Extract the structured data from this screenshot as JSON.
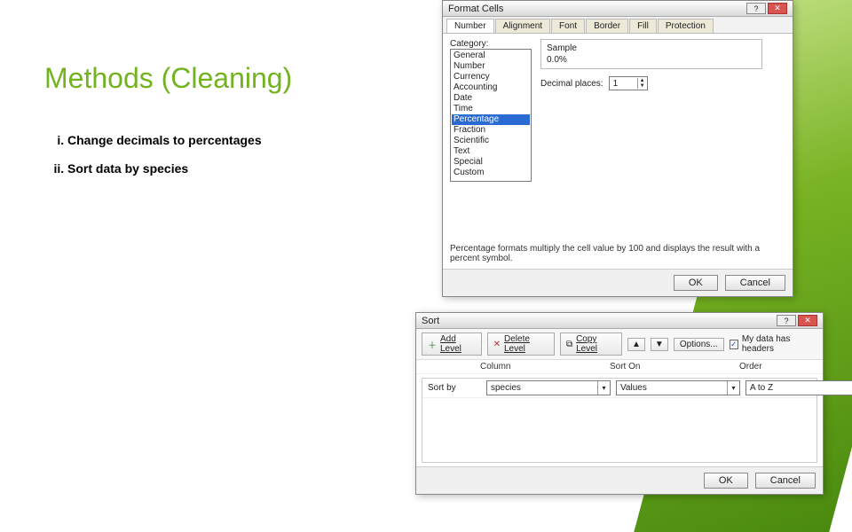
{
  "slide": {
    "title": "Methods (Cleaning)",
    "bullets": [
      "Change decimals to percentages",
      "Sort data by species"
    ]
  },
  "formatCells": {
    "title": "Format Cells",
    "tabs": [
      "Number",
      "Alignment",
      "Font",
      "Border",
      "Fill",
      "Protection"
    ],
    "activeTab": "Number",
    "categoryLabel": "Category:",
    "categories": [
      "General",
      "Number",
      "Currency",
      "Accounting",
      "Date",
      "Time",
      "Percentage",
      "Fraction",
      "Scientific",
      "Text",
      "Special",
      "Custom"
    ],
    "selectedCategory": "Percentage",
    "sampleLabel": "Sample",
    "sampleValue": "0.0%",
    "decimalPlacesLabel": "Decimal places:",
    "decimalPlaces": "1",
    "hint": "Percentage formats multiply the cell value by 100 and displays the result with a percent symbol.",
    "ok": "OK",
    "cancel": "Cancel"
  },
  "sort": {
    "title": "Sort",
    "toolbar": {
      "addLevel": "Add Level",
      "deleteLevel": "Delete Level",
      "copyLevel": "Copy Level",
      "options": "Options...",
      "headersCheckbox": "My data has headers",
      "headersChecked": true
    },
    "columns": {
      "col": "Column",
      "sortOn": "Sort On",
      "order": "Order"
    },
    "row": {
      "label": "Sort by",
      "column": "species",
      "sortOn": "Values",
      "order": "A to Z"
    },
    "ok": "OK",
    "cancel": "Cancel"
  }
}
